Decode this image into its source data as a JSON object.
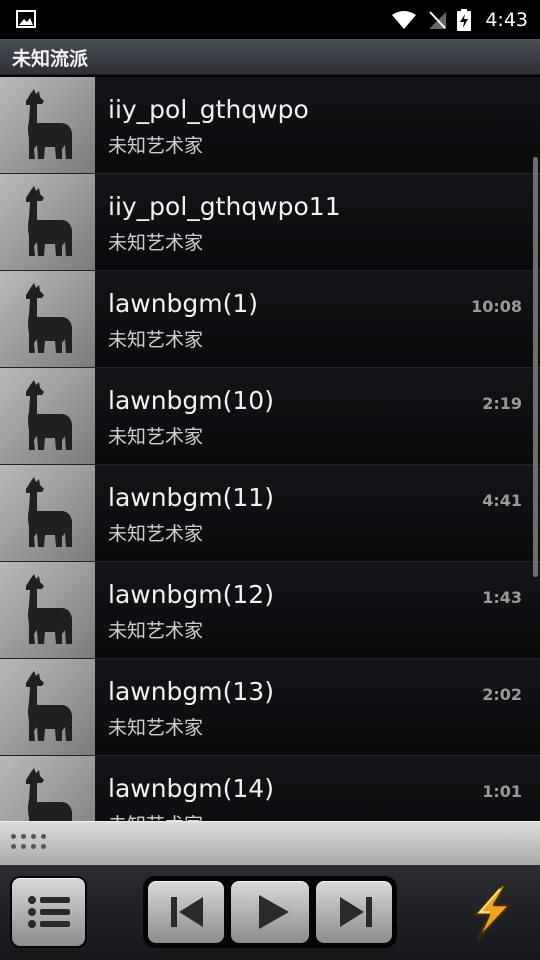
{
  "status_bar": {
    "time": "4:43",
    "icons": [
      "image-notification-icon",
      "wifi-icon",
      "no-signal-icon",
      "battery-charging-icon"
    ]
  },
  "header": {
    "title": "未知流派"
  },
  "tracks": [
    {
      "title": "iiy_pol_gthqwpo",
      "artist": "未知艺术家",
      "duration": ""
    },
    {
      "title": "iiy_pol_gthqwpo11",
      "artist": "未知艺术家",
      "duration": ""
    },
    {
      "title": "lawnbgm(1)",
      "artist": "未知艺术家",
      "duration": "10:08"
    },
    {
      "title": "lawnbgm(10)",
      "artist": "未知艺术家",
      "duration": "2:19"
    },
    {
      "title": "lawnbgm(11)",
      "artist": "未知艺术家",
      "duration": "4:41"
    },
    {
      "title": "lawnbgm(12)",
      "artist": "未知艺术家",
      "duration": "1:43"
    },
    {
      "title": "lawnbgm(13)",
      "artist": "未知艺术家",
      "duration": "2:02"
    },
    {
      "title": "lawnbgm(14)",
      "artist": "未知艺术家",
      "duration": "1:01"
    }
  ],
  "controls": {
    "icons": [
      "list-icon",
      "previous-icon",
      "play-icon",
      "next-icon",
      "lightning-bolt-icon"
    ]
  },
  "colors": {
    "accent": "#f0a21c"
  }
}
